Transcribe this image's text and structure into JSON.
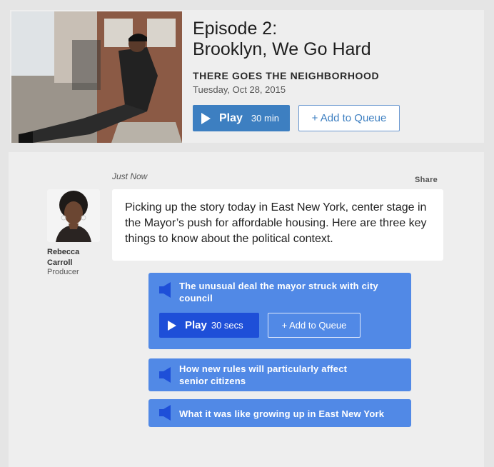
{
  "episode": {
    "title_line1": "Episode 2:",
    "title_line2": "Brooklyn, We Go Hard",
    "show": "THERE GOES THE NEIGHBORHOOD",
    "date": "Tuesday, Oct 28, 2015",
    "play_label": "Play",
    "play_duration": "30 min",
    "queue_label": "+ Add to Queue"
  },
  "post": {
    "timestamp": "Just Now",
    "share": "Share",
    "author_name": "Rebecca Carroll",
    "author_role": "Producer",
    "body": "Picking up the story today in East New York, center stage in the Mayor’s push for affordable housing. Here are three key things to know about the political context."
  },
  "clips": [
    {
      "title": "The unusual deal the mayor struck with city council",
      "play_label": "Play",
      "duration": "30 secs",
      "queue_label": "+ Add to Queue"
    },
    {
      "title": "How new rules will particularly affect senior citizens"
    },
    {
      "title": "What it was like growing up in East New York"
    }
  ],
  "colors": {
    "play_button": "#3d7fc1",
    "clip_background": "#5189e6",
    "clip_play_button": "#1e4fd8",
    "speaker_icon": "#1e4fd8"
  }
}
